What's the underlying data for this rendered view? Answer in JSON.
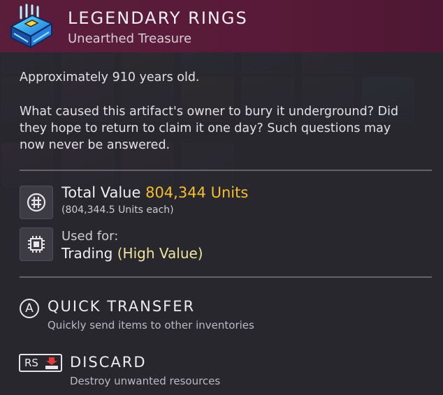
{
  "item": {
    "name": "LEGENDARY RINGS",
    "category": "Unearthed Treasure",
    "icon": "treasure-chest-icon"
  },
  "description": {
    "age": "Approximately 910 years old.",
    "lore": "What caused this artifact's owner to bury it underground? Did they hope to return to claim it one day? Such questions may now never be answered."
  },
  "value": {
    "label": "Total Value",
    "amount": "804,344 Units",
    "each": "(804,344.5 Units each)",
    "icon": "units-currency-icon",
    "amount_color": "#f5bf2c"
  },
  "usage": {
    "label": "Used for:",
    "value": "Trading",
    "qualifier": "(High Value)",
    "icon": "chip-icon",
    "qualifier_color": "#f0e59a"
  },
  "actions": [
    {
      "button": "A",
      "label": "QUICK TRANSFER",
      "description": "Quickly send items to other inventories"
    },
    {
      "button": "RS",
      "label": "DISCARD",
      "description": "Destroy unwanted resources"
    }
  ],
  "colors": {
    "header_bg": "#5a1d3a",
    "panel_bg": "#2a2930"
  }
}
